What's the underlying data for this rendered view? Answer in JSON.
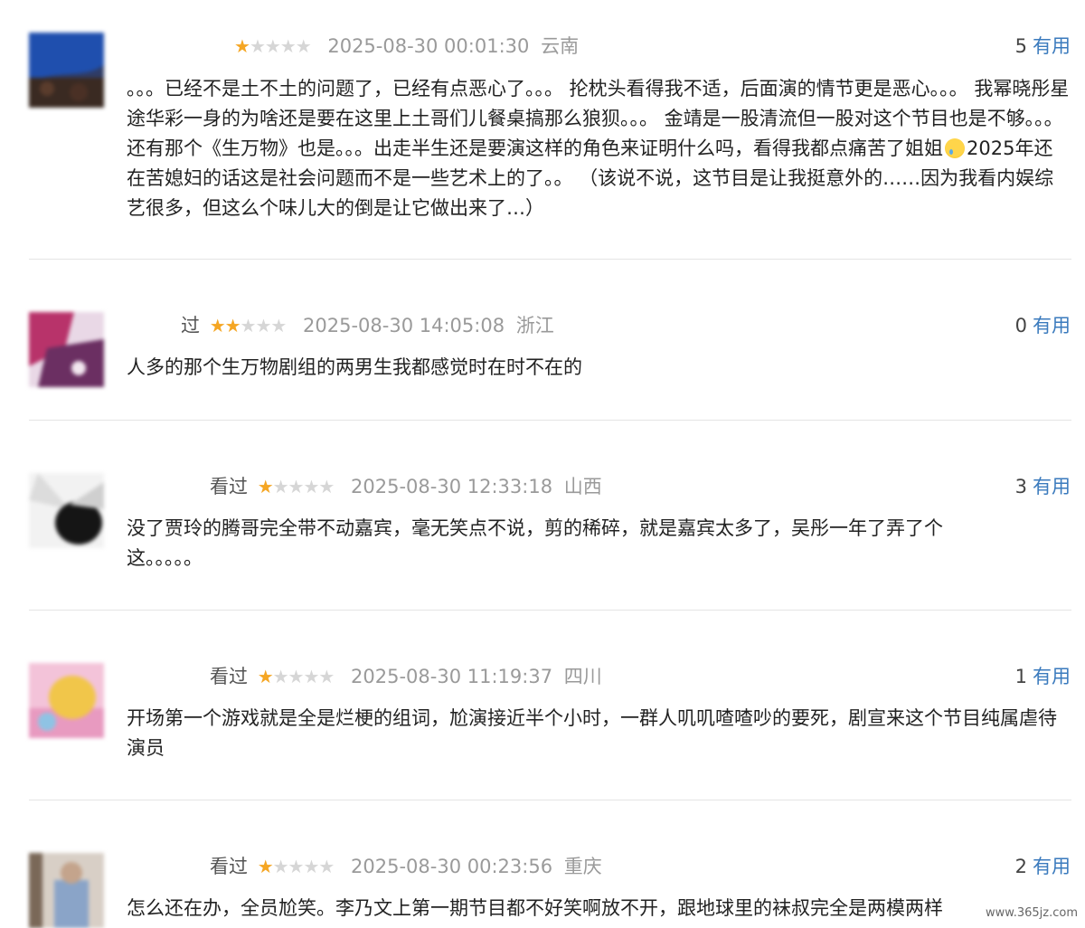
{
  "reviews": [
    {
      "name": "",
      "stars": 1,
      "time": "2025-08-30 00:01:30",
      "location": "云南",
      "useful_count": "5",
      "useful_label": "有用",
      "text_before_emoji": "。。。已经不是土不土的问题了，已经有点恶心了。。。 抡枕头看得我不适，后面演的情节更是恶心。。。 我幂晓彤星途华彩一身的为啥还是要在这里上土哥们儿餐桌搞那么狼狈。。。 金靖是一股清流但一股对这个节目也是不够。。。 还有那个《生万物》也是。。。出走半生还是要演这样的角色来证明什么吗，看得我都点痛苦了姐姐",
      "text_after_emoji": "2025年还在苦媳妇的话这是社会问题而不是一些艺术上的了。。 （该说不说，这节目是让我挺意外的……因为我看内娱综艺很多，但这么个味儿大的倒是让它做出来了…）",
      "avatar_colors": [
        "#1d3f8a",
        "#2f5fbf",
        "#3c2a22"
      ]
    },
    {
      "name": "过",
      "stars": 2,
      "time": "2025-08-30 14:05:08",
      "location": "浙江",
      "useful_count": "0",
      "useful_label": "有用",
      "text": "人多的那个生万物剧组的两男生我都感觉时在时不在的",
      "avatar_colors": [
        "#b43a6e",
        "#6d2b5c",
        "#e6d5e8"
      ]
    },
    {
      "name": "看过",
      "stars": 1,
      "time": "2025-08-30 12:33:18",
      "location": "山西",
      "useful_count": "3",
      "useful_label": "有用",
      "text": "没了贾玲的腾哥完全带不动嘉宾，毫无笑点不说，剪的稀碎，就是嘉宾太多了，吴彤一年了弄了个这。。。。。",
      "avatar_colors": [
        "#f2f2f2",
        "#111111",
        "#d8d8d8"
      ]
    },
    {
      "name": "看过",
      "stars": 1,
      "time": "2025-08-30 11:19:37",
      "location": "四川",
      "useful_count": "1",
      "useful_label": "有用",
      "text": "开场第一个游戏就是全是烂梗的组词，尬演接近半个小时，一群人叽叽喳喳吵的要死，剧宣来这个节目纯属虐待演员",
      "avatar_colors": [
        "#f3b6d2",
        "#f1c84a",
        "#8fc7e8"
      ]
    },
    {
      "name": "看过",
      "stars": 1,
      "time": "2025-08-30 00:23:56",
      "location": "重庆",
      "useful_count": "2",
      "useful_label": "有用",
      "text": "怎么还在办，全员尬笑。李乃文上第一期节目都不好笑啊放不开，跟地球里的袜叔完全是两模两样",
      "avatar_colors": [
        "#c9b8a8",
        "#8aa4c8",
        "#5b4a3e"
      ]
    }
  ],
  "watermark": "www.365jz.com"
}
